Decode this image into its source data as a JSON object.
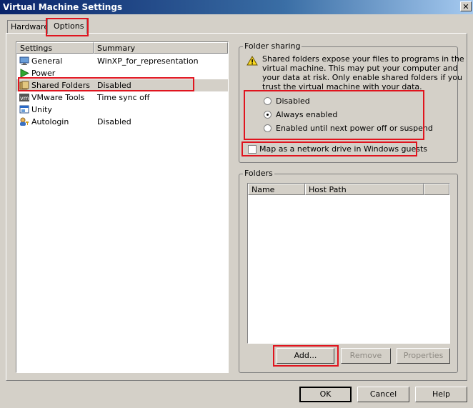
{
  "window": {
    "title": "Virtual Machine Settings",
    "close_glyph": "✕"
  },
  "tabs": [
    {
      "label": "Hardware"
    },
    {
      "label": "Options"
    }
  ],
  "settings_list": {
    "columns": [
      "Settings",
      "Summary"
    ],
    "items": [
      {
        "name": "General",
        "summary": "WinXP_for_representation",
        "icon": "general-icon"
      },
      {
        "name": "Power",
        "summary": "",
        "icon": "power-icon"
      },
      {
        "name": "Shared Folders",
        "summary": "Disabled",
        "icon": "shared-folders-icon",
        "selected": true
      },
      {
        "name": "VMware Tools",
        "summary": "Time sync off",
        "icon": "vmware-tools-icon"
      },
      {
        "name": "Unity",
        "summary": "",
        "icon": "unity-icon"
      },
      {
        "name": "Autologin",
        "summary": "Disabled",
        "icon": "autologin-icon"
      }
    ]
  },
  "folder_sharing": {
    "title": "Folder sharing",
    "warning_lines": [
      "Shared folders expose your files to programs in the",
      "virtual machine. This may put your computer and",
      "your data at risk. Only enable shared folders if you",
      "trust the virtual machine with your data."
    ],
    "options": [
      {
        "label": "Disabled",
        "selected": false
      },
      {
        "label": "Always enabled",
        "selected": true
      },
      {
        "label": "Enabled until next power off or suspend",
        "selected": false
      }
    ],
    "map_drive_label": "Map as a network drive in Windows guests",
    "map_drive_checked": false
  },
  "folders": {
    "title": "Folders",
    "columns": [
      "Name",
      "Host Path"
    ],
    "add_label": "Add...",
    "remove_label": "Remove",
    "properties_label": "Properties"
  },
  "footer": {
    "ok_label": "OK",
    "cancel_label": "Cancel",
    "help_label": "Help"
  },
  "colors": {
    "highlight_red": "#e0141e",
    "title_blue": "#0a246a"
  }
}
